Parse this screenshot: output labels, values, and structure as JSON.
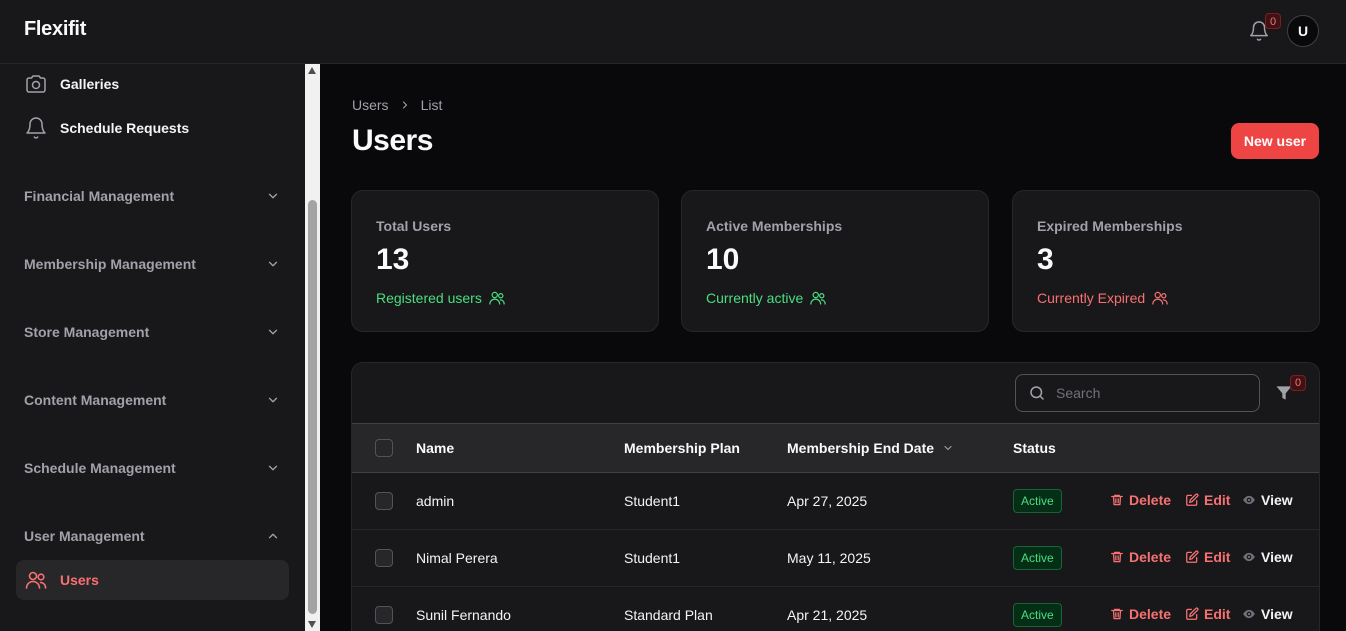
{
  "header": {
    "brand": "Flexifit",
    "notification_count": "0",
    "avatar_initial": "U"
  },
  "sidebar": {
    "items": [
      {
        "label": "Galleries",
        "icon": "camera-icon"
      },
      {
        "label": "Schedule Requests",
        "icon": "bell-icon"
      }
    ],
    "groups": [
      {
        "label": "Financial Management",
        "expanded": false
      },
      {
        "label": "Membership Management",
        "expanded": false
      },
      {
        "label": "Store Management",
        "expanded": false
      },
      {
        "label": "Content Management",
        "expanded": false
      },
      {
        "label": "Schedule Management",
        "expanded": false
      },
      {
        "label": "User Management",
        "expanded": true
      }
    ],
    "active_item": {
      "label": "Users",
      "icon": "users-icon"
    }
  },
  "breadcrumb": {
    "root": "Users",
    "current": "List"
  },
  "page": {
    "title": "Users",
    "new_button": "New user"
  },
  "stats": [
    {
      "label": "Total Users",
      "value": "13",
      "description": "Registered users",
      "color": "#4ade80"
    },
    {
      "label": "Active Memberships",
      "value": "10",
      "description": "Currently active",
      "color": "#4ade80"
    },
    {
      "label": "Expired Memberships",
      "value": "3",
      "description": "Currently Expired",
      "color": "#f87171"
    }
  ],
  "table": {
    "search_placeholder": "Search",
    "filter_count": "0",
    "columns": [
      "Name",
      "Membership Plan",
      "Membership End Date",
      "Status"
    ],
    "rows": [
      {
        "name": "admin",
        "plan": "Student1",
        "end_date": "Apr 27, 2025",
        "status": "Active"
      },
      {
        "name": "Nimal Perera",
        "plan": "Student1",
        "end_date": "May 11, 2025",
        "status": "Active"
      },
      {
        "name": "Sunil Fernando",
        "plan": "Standard Plan",
        "end_date": "Apr 21, 2025",
        "status": "Active"
      }
    ],
    "actions": {
      "delete": "Delete",
      "edit": "Edit",
      "view": "View"
    }
  },
  "colors": {
    "accent": "#ef4444",
    "background": "#09090b",
    "surface": "#18181b",
    "success": "#4ade80"
  }
}
